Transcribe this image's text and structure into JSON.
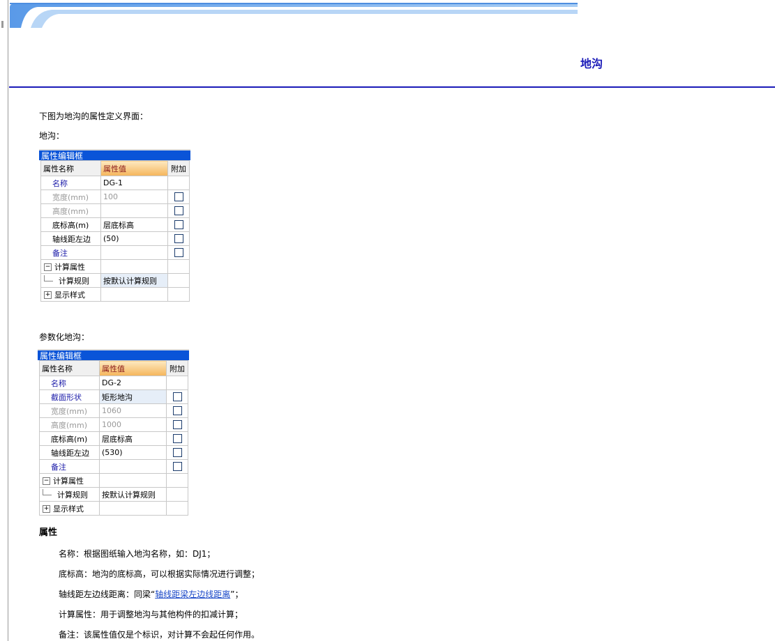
{
  "header": {
    "title": "地沟"
  },
  "intro": "下图为地沟的属性定义界面：",
  "section1_label": "地沟：",
  "section2_label": "参数化地沟：",
  "panel_title": "属性编辑框",
  "col_headers": {
    "name": "属性名称",
    "value": "属性值",
    "extra": "附加"
  },
  "panel1": {
    "rows": [
      {
        "label": "名称",
        "value": "DG-1"
      },
      {
        "label": "宽度(mm)",
        "value": "100"
      },
      {
        "label": "高度(mm)",
        "value": ""
      },
      {
        "label": "底标高(m)",
        "value": "层底标高"
      },
      {
        "label": "轴线距左边",
        "value": "(50)"
      },
      {
        "label": "备注",
        "value": ""
      }
    ],
    "group_calc": "计算属性",
    "calc_rule_label": "计算规则",
    "calc_rule_value": "按默认计算规则",
    "group_display": "显示样式"
  },
  "panel2": {
    "rows": [
      {
        "label": "名称",
        "value": "DG-2"
      },
      {
        "label": "截面形状",
        "value": "矩形地沟"
      },
      {
        "label": "宽度(mm)",
        "value": "1060"
      },
      {
        "label": "高度(mm)",
        "value": "1000"
      },
      {
        "label": "底标高(m)",
        "value": "层底标高"
      },
      {
        "label": "轴线距左边",
        "value": "(530)"
      },
      {
        "label": "备注",
        "value": ""
      }
    ],
    "group_calc": "计算属性",
    "calc_rule_label": "计算规则",
    "calc_rule_value": "按默认计算规则",
    "group_display": "显示样式"
  },
  "props_heading": "属性",
  "props": {
    "name": "名称：根据图纸输入地沟名称，如：DJ1；",
    "elev": "底标高：地沟的底标高，可以根据实际情况进行调整；",
    "axis_prefix": "轴线距左边线距离：同梁“",
    "axis_link": "轴线距梁左边线距离",
    "axis_suffix": "”；",
    "calc": "计算属性：用于调整地沟与其他构件的扣减计算；",
    "note": "备注：该属性值仅是个标识，对计算不会起任何作用。"
  },
  "colors": {
    "accent": "#1a1ab8",
    "panel_title_bg": "#0a54d8",
    "link": "#1a48c8"
  }
}
